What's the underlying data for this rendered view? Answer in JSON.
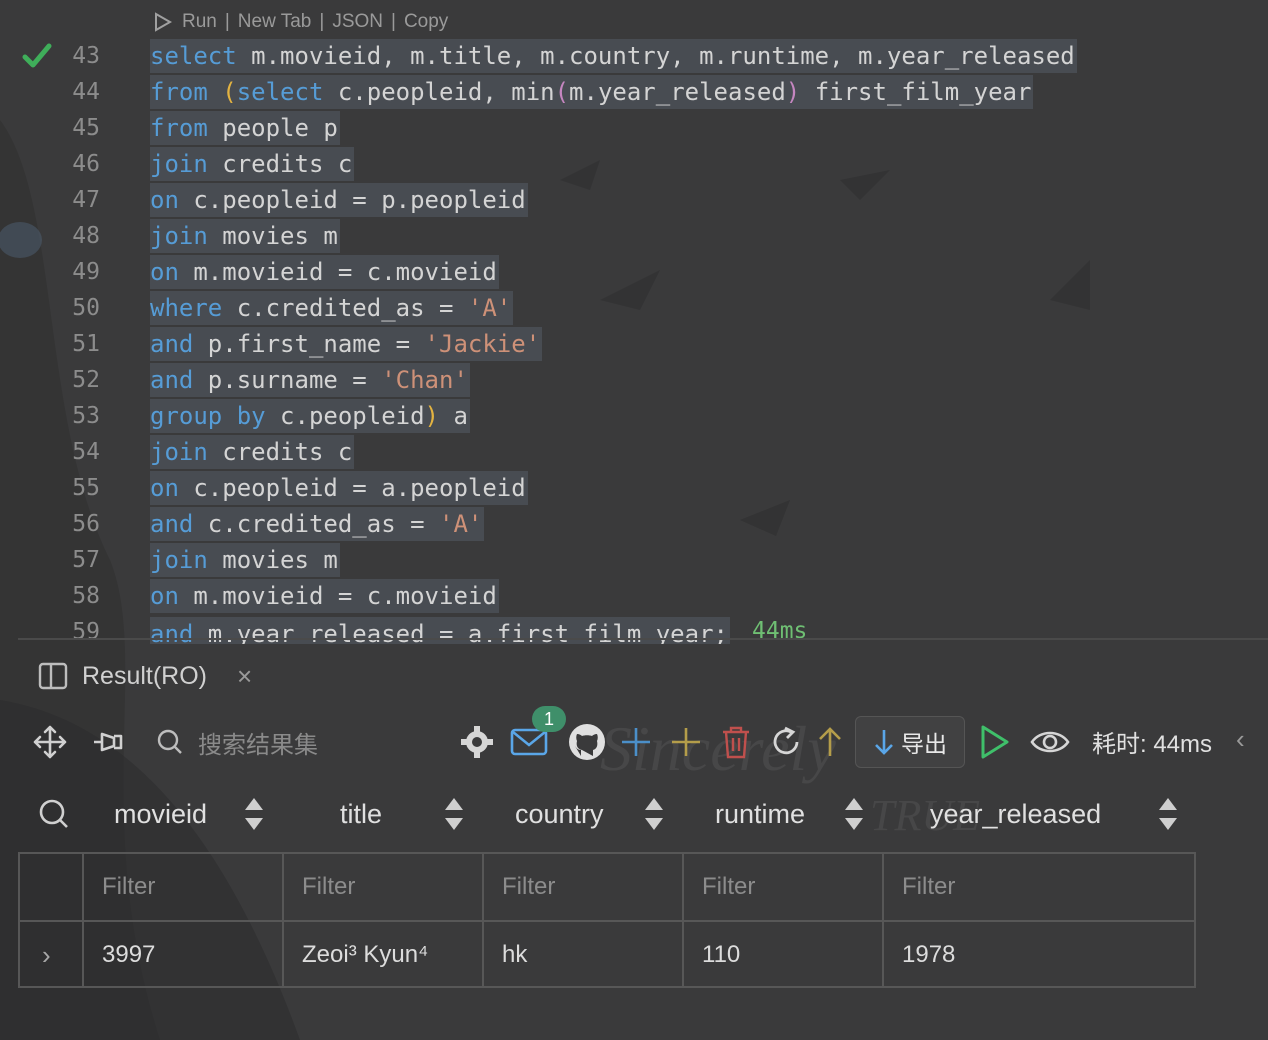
{
  "codelens": {
    "run": "Run",
    "new_tab": "New Tab",
    "json": "JSON",
    "copy": "Copy",
    "sep": "|"
  },
  "editor": {
    "lines": [
      {
        "num": "43"
      },
      {
        "num": "44"
      },
      {
        "num": "45"
      },
      {
        "num": "46"
      },
      {
        "num": "47"
      },
      {
        "num": "48"
      },
      {
        "num": "49"
      },
      {
        "num": "50"
      },
      {
        "num": "51"
      },
      {
        "num": "52"
      },
      {
        "num": "53"
      },
      {
        "num": "54"
      },
      {
        "num": "55"
      },
      {
        "num": "56"
      },
      {
        "num": "57"
      },
      {
        "num": "58"
      },
      {
        "num": "59"
      }
    ],
    "code": {
      "l43": [
        "select",
        " m.movieid, m.title, m.country, m.runtime, m.year_released"
      ],
      "l44": [
        "from",
        " ",
        "(",
        "select",
        " c.peopleid, min",
        "(",
        "m.year_released",
        ")",
        " first_film_year"
      ],
      "l45": [
        "from",
        " people p"
      ],
      "l46": [
        "join",
        " credits c"
      ],
      "l47": [
        "on",
        " c.peopleid = p.peopleid"
      ],
      "l48": [
        "join",
        " movies m"
      ],
      "l49": [
        "on",
        " m.movieid = c.movieid"
      ],
      "l50": [
        "where",
        " c.credited_as = ",
        "'A'"
      ],
      "l51": [
        "and",
        " p.first_name = ",
        "'Jackie'"
      ],
      "l52": [
        "and",
        " p.surname = ",
        "'Chan'"
      ],
      "l53": [
        "group by",
        " c.peopleid",
        ")",
        " a"
      ],
      "l54": [
        "join",
        " credits c"
      ],
      "l55": [
        "on",
        " c.peopleid = a.peopleid"
      ],
      "l56": [
        "and",
        " c.credited_as = ",
        "'A'"
      ],
      "l57": [
        "join",
        " movies m"
      ],
      "l58": [
        "on",
        " m.movieid = c.movieid"
      ],
      "l59": [
        "and",
        " m.year_released = a.first_film_year;",
        "44ms"
      ]
    }
  },
  "result_tab": {
    "label": "Result(RO)",
    "close": "×"
  },
  "toolbar": {
    "search_placeholder": "搜索结果集",
    "badge_count": "1",
    "export_label": "导出",
    "cost_label": "耗时: 44ms",
    "collapse": "‹"
  },
  "table": {
    "columns": [
      "movieid",
      "title",
      "country",
      "runtime",
      "year_released"
    ],
    "filter_placeholder": "Filter",
    "rows": [
      {
        "expander": "›",
        "movieid": "3997",
        "title": "Zeoi³ Kyun⁴",
        "country": "hk",
        "runtime": "110",
        "year_released": "1978"
      }
    ]
  },
  "colors": {
    "keyword": "#569cd6",
    "string": "#ce9178",
    "success": "#3fae5a",
    "badge": "#3f8f6a"
  }
}
